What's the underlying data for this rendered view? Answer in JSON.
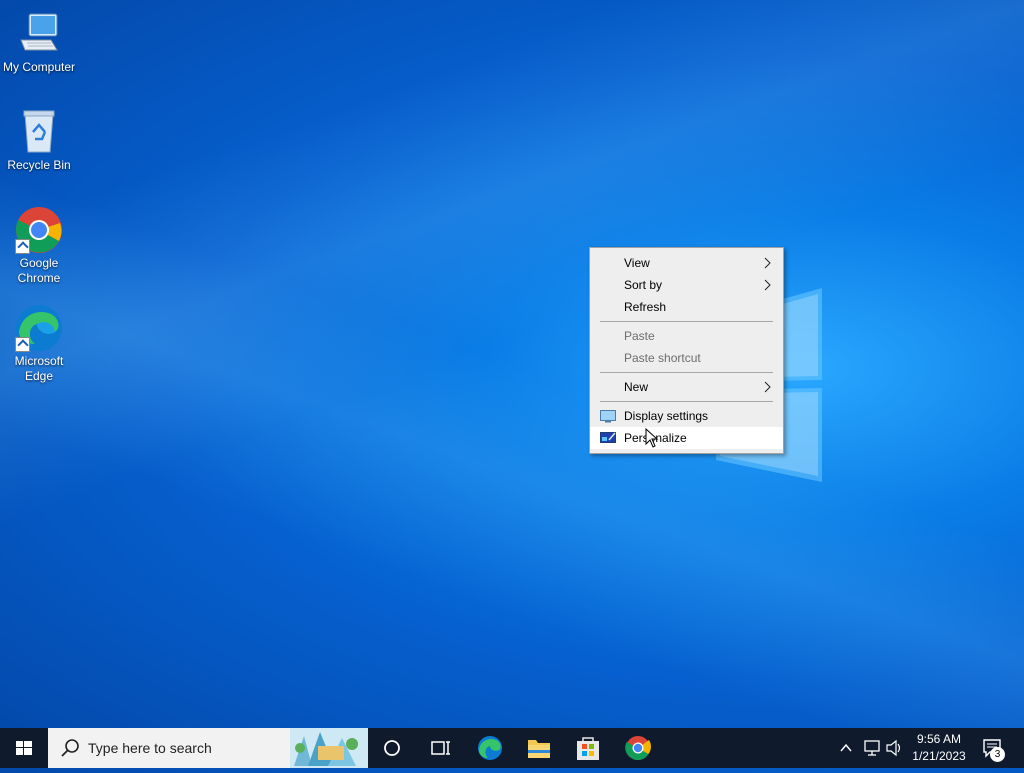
{
  "desktop": {
    "icons": [
      {
        "label": "My Computer",
        "icon": "computer-icon"
      },
      {
        "label": "Recycle Bin",
        "icon": "recycle-bin-icon"
      },
      {
        "label": "Google Chrome",
        "icon": "chrome-icon"
      },
      {
        "label": "Microsoft Edge",
        "icon": "edge-icon"
      }
    ]
  },
  "context_menu": {
    "items": [
      {
        "label": "View",
        "submenu": true,
        "enabled": true
      },
      {
        "label": "Sort by",
        "submenu": true,
        "enabled": true
      },
      {
        "label": "Refresh",
        "submenu": false,
        "enabled": true
      },
      {
        "label": "Paste",
        "submenu": false,
        "enabled": false
      },
      {
        "label": "Paste shortcut",
        "submenu": false,
        "enabled": false
      },
      {
        "label": "New",
        "submenu": true,
        "enabled": true
      },
      {
        "label": "Display settings",
        "icon": "display-icon",
        "enabled": true
      },
      {
        "label": "Personalize",
        "icon": "personalize-icon",
        "enabled": true,
        "hovered": true
      }
    ]
  },
  "taskbar": {
    "search_placeholder": "Type here to search",
    "pinned": [
      "cortana-icon",
      "task-view-icon",
      "edge-icon",
      "file-explorer-icon",
      "store-icon",
      "chrome-icon"
    ],
    "clock": {
      "time": "9:56 AM",
      "date": "1/21/2023"
    },
    "notifications_count": "3"
  },
  "colors": {
    "taskbar": "#0f1a2d",
    "menu_bg": "#eeeeee",
    "desktop_accent": "#0a7de6"
  }
}
